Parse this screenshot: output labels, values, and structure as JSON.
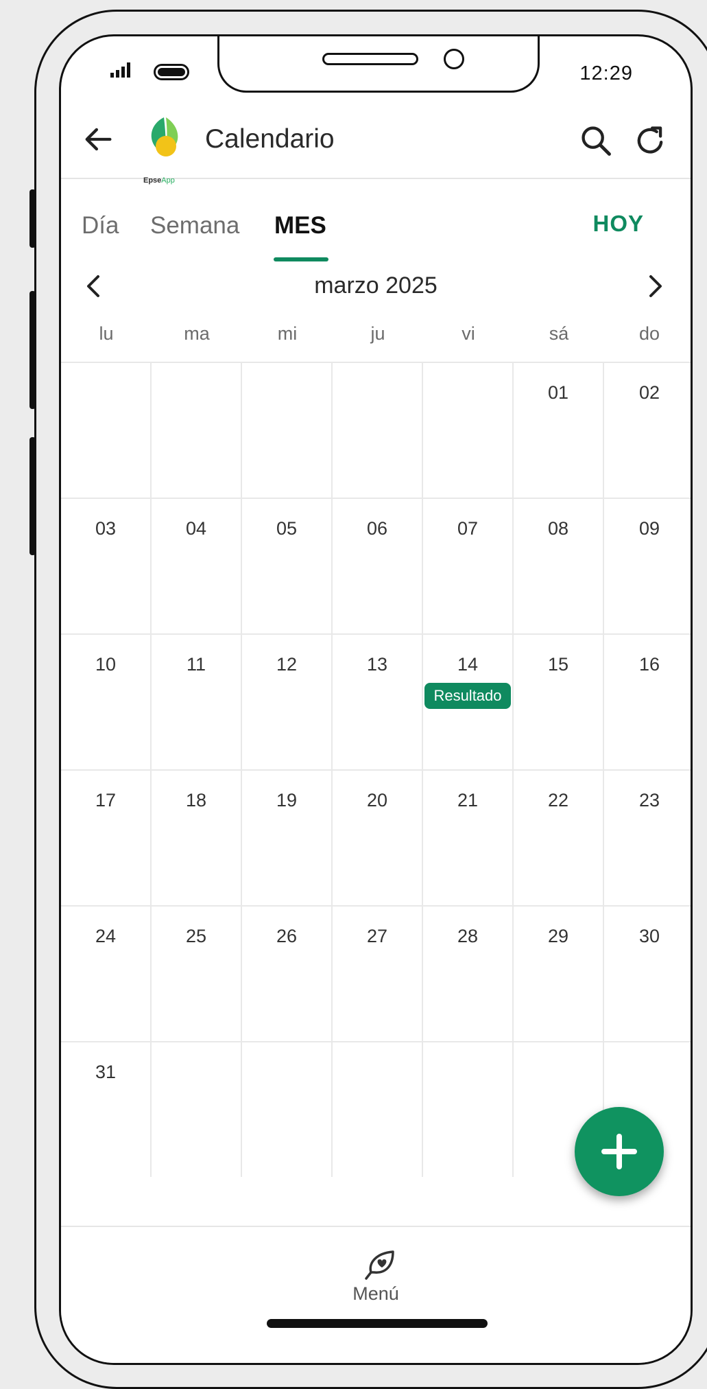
{
  "status": {
    "time": "12:29"
  },
  "appbar": {
    "title": "Calendario",
    "logo_text_dark": "Epse",
    "logo_text_green": "App"
  },
  "tabs": [
    {
      "label": "Día",
      "active": false
    },
    {
      "label": "Semana",
      "active": false
    },
    {
      "label": "MES",
      "active": true
    }
  ],
  "today_label": "HOY",
  "month_title": "marzo 2025",
  "weekdays": [
    "lu",
    "ma",
    "mi",
    "ju",
    "vi",
    "sá",
    "do"
  ],
  "weeks": [
    [
      "",
      "",
      "",
      "",
      "",
      "01",
      "02"
    ],
    [
      "03",
      "04",
      "05",
      "06",
      "07",
      "08",
      "09"
    ],
    [
      "10",
      "11",
      "12",
      "13",
      "14",
      "15",
      "16"
    ],
    [
      "17",
      "18",
      "19",
      "20",
      "21",
      "22",
      "23"
    ],
    [
      "24",
      "25",
      "26",
      "27",
      "28",
      "29",
      "30"
    ],
    [
      "31",
      "",
      "",
      "",
      "",
      "",
      ""
    ]
  ],
  "events": [
    {
      "day": "14",
      "label": "Resultado"
    }
  ],
  "bottom_nav": {
    "menu_label": "Menú"
  },
  "icons": {
    "back": "arrow-left-icon",
    "search": "search-icon",
    "refresh": "refresh-icon",
    "prev": "chevron-left-icon",
    "next": "chevron-right-icon",
    "add": "plus-icon",
    "menu": "leaf-heart-icon"
  },
  "colors": {
    "accent": "#0f8a5f",
    "fab": "#109360"
  }
}
